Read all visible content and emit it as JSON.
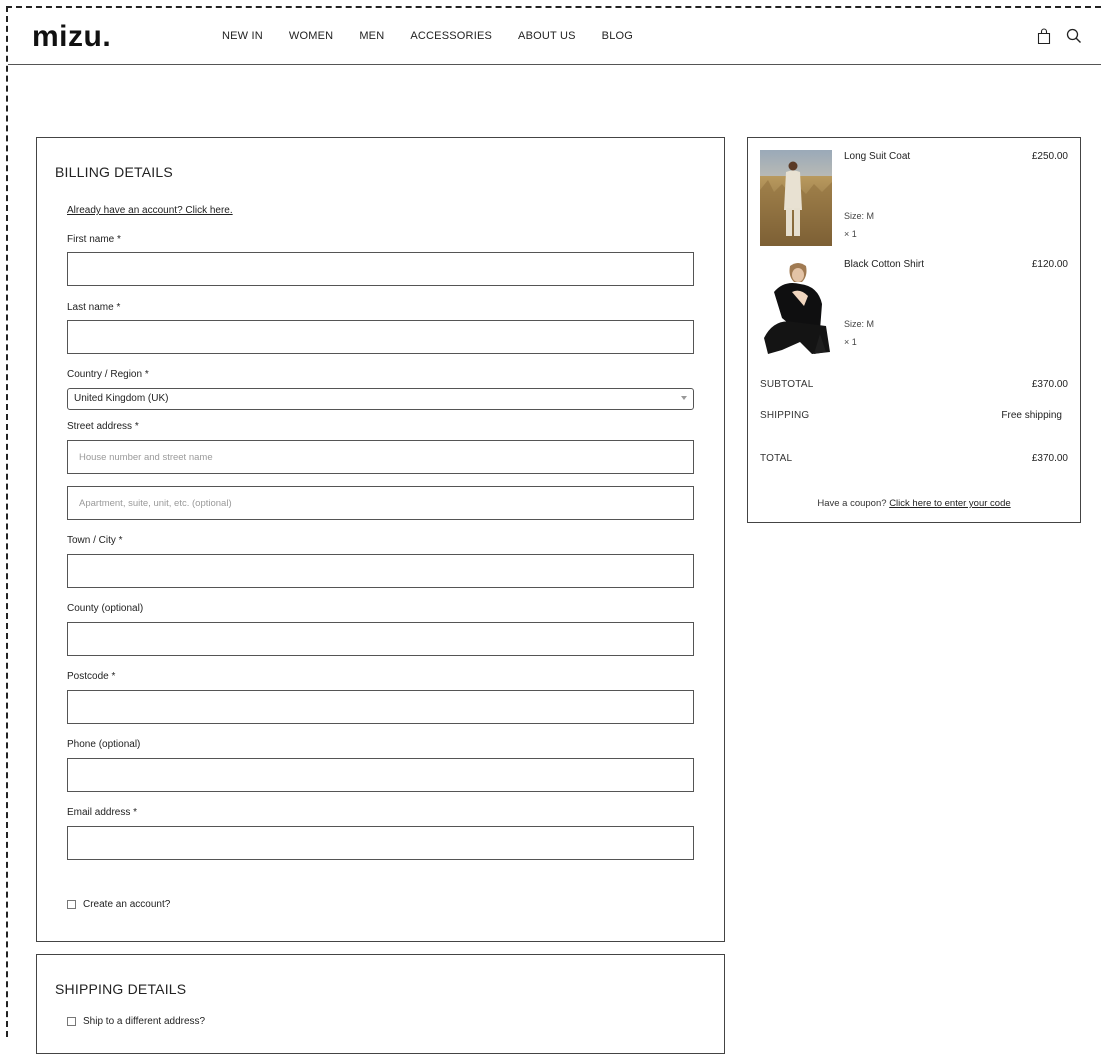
{
  "header": {
    "logo": "mizu.",
    "nav": [
      "NEW IN",
      "WOMEN",
      "MEN",
      "ACCESSORIES",
      "ABOUT US",
      "BLOG"
    ],
    "icons": [
      "bag-icon",
      "search-icon"
    ]
  },
  "billing": {
    "title": "BILLING DETAILS",
    "account_link": "Already have an account? Click here.",
    "first_name_label": "First name *",
    "last_name_label": "Last name *",
    "country_label": "Country / Region *",
    "country_value": "United Kingdom (UK)",
    "street_label": "Street address *",
    "street_placeholder": "House number and street name",
    "apartment_placeholder": "Apartment, suite, unit, etc. (optional)",
    "town_label": "Town / City *",
    "county_label": "County (optional)",
    "postcode_label": "Postcode *",
    "phone_label": "Phone (optional)",
    "email_label": "Email address *",
    "create_account_label": "Create an account?"
  },
  "shipping_details": {
    "title": "SHIPPING DETAILS",
    "different_address_label": "Ship to a different address?"
  },
  "order": {
    "items": [
      {
        "name": "Long Suit Coat",
        "price": "£250.00",
        "size": "Size:  M",
        "qty": "× 1"
      },
      {
        "name": "Black Cotton Shirt",
        "price": "£120.00",
        "size": "Size:  M",
        "qty": "× 1"
      }
    ],
    "subtotal_label": "SUBTOTAL",
    "subtotal_value": "£370.00",
    "shipping_label": "SHIPPING",
    "shipping_value": "Free shipping",
    "total_label": "TOTAL",
    "total_value": "£370.00",
    "coupon_text": "Have a coupon?",
    "coupon_link": "Click here to enter your code"
  }
}
